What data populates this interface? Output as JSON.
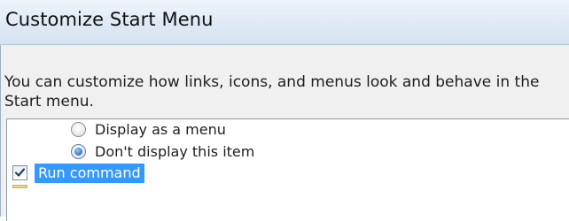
{
  "window": {
    "title": "Customize Start Menu"
  },
  "description": "You can customize how links, icons, and menus look and behave in the Start menu.",
  "options": {
    "display_as_menu": {
      "label": "Display as a menu",
      "checked": false
    },
    "dont_display": {
      "label": "Don't display this item",
      "checked": true
    },
    "run_command": {
      "label": "Run command",
      "checked": true,
      "selected": true
    }
  },
  "colors": {
    "selection": "#3399ff",
    "titlebar": "#dfe9f5",
    "dialog_background": "#f0f0f0"
  }
}
